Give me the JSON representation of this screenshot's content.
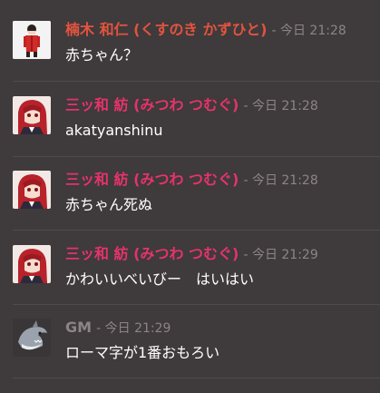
{
  "colors": {
    "background": "#3f3a3c",
    "name_kusunoki": "#e2543e",
    "name_mitsuwa": "#e5336b",
    "name_gm": "#8c8587",
    "timestamp": "#8c8587",
    "message_text": "#ffffff"
  },
  "messages": [
    {
      "author": "楠木 和仁 (くすのき かずひと)",
      "time": "- 今日 21:28",
      "text": "赤ちゃん？",
      "avatar_icon": "character-red-uniform-icon"
    },
    {
      "author": "三ッ和 紡 (みつわ つむぐ)",
      "time": "- 今日 21:28",
      "text": "akatyanshinu",
      "avatar_icon": "character-red-hair-icon"
    },
    {
      "author": "三ッ和 紡 (みつわ つむぐ)",
      "time": "- 今日 21:28",
      "text": "赤ちゃん死ぬ",
      "avatar_icon": "character-red-hair-icon"
    },
    {
      "author": "三ッ和 紡 (みつわ つむぐ)",
      "time": "- 今日 21:29",
      "text": "かわいいべいびー　はいはい",
      "avatar_icon": "character-red-hair-icon"
    },
    {
      "author": "GM",
      "time": "- 今日 21:29",
      "text": "ローマ字が1番おもろい",
      "avatar_icon": "shark-icon"
    }
  ]
}
